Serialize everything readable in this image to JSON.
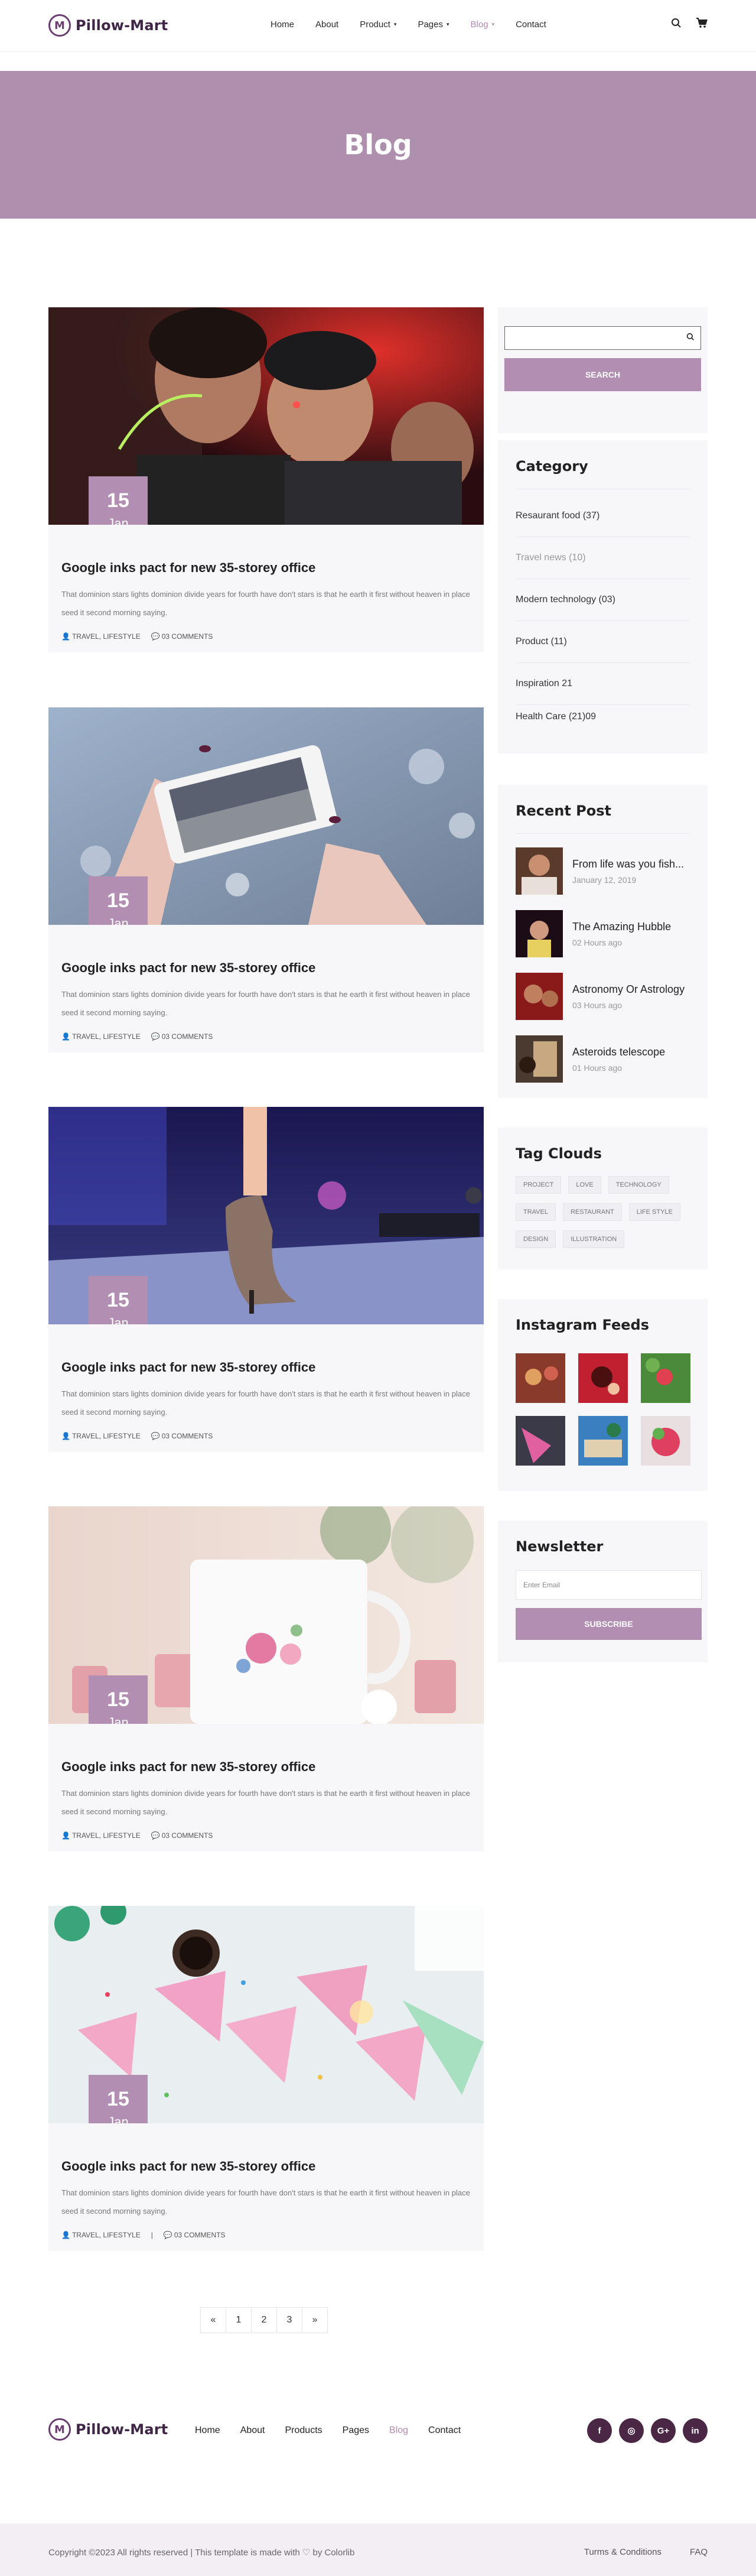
{
  "brand": {
    "logo_letter": "M",
    "name": "Pillow-Mart"
  },
  "nav": {
    "items": [
      {
        "label": "Home",
        "caret": ""
      },
      {
        "label": "About",
        "caret": ""
      },
      {
        "label": "Product",
        "caret": "▾"
      },
      {
        "label": "Pages",
        "caret": "▾"
      },
      {
        "label": "Blog",
        "caret": "▾"
      },
      {
        "label": "Contact",
        "caret": ""
      }
    ],
    "search_icon": "🔍",
    "cart_icon": "🛒"
  },
  "banner": {
    "title": "Blog"
  },
  "posts": [
    {
      "day": "15",
      "month": "Jan",
      "title": "Google inks pact for new 35-storey office",
      "excerpt": "That dominion stars lights dominion divide years for fourth have don't stars is that he earth it first without heaven in place seed it second morning saying.",
      "category": "TRAVEL, LIFESTYLE",
      "comments": "03 COMMENTS",
      "image": "party"
    },
    {
      "day": "15",
      "month": "Jan",
      "title": "Google inks pact for new 35-storey office",
      "excerpt": "That dominion stars lights dominion divide years for fourth have don't stars is that he earth it first without heaven in place seed it second morning saying.",
      "category": "TRAVEL, LIFESTYLE",
      "comments": "03 COMMENTS",
      "image": "phone"
    },
    {
      "day": "15",
      "month": "Jan",
      "title": "Google inks pact for new 35-storey office",
      "excerpt": "That dominion stars lights dominion divide years for fourth have don't stars is that he earth it first without heaven in place seed it second morning saying.",
      "category": "TRAVEL, LIFESTYLE",
      "comments": "03 COMMENTS",
      "image": "stage"
    },
    {
      "day": "15",
      "month": "Jan",
      "title": "Google inks pact for new 35-storey office",
      "excerpt": "That dominion stars lights dominion divide years for fourth have don't stars is that he earth it first without heaven in place seed it second morning saying.",
      "category": "TRAVEL, LIFESTYLE",
      "comments": "03 COMMENTS",
      "image": "mug"
    },
    {
      "day": "15",
      "month": "Jan",
      "title": "Google inks pact for new 35-storey office",
      "excerpt": "That dominion stars lights dominion divide years for fourth have don't stars is that he earth it first without heaven in place seed it second morning saying.",
      "category": "TRAVEL, LIFESTYLE",
      "comments": "03 COMMENTS",
      "image": "cake"
    }
  ],
  "sidebar": {
    "search": {
      "placeholder": "",
      "button": "SEARCH"
    },
    "category": {
      "title": "Category",
      "items": [
        "Resaurant food (37)",
        "Travel news (10)",
        "Modern technology (03)",
        "Product (11)",
        "Inspiration 21",
        "Health Care (21)09"
      ]
    },
    "recent": {
      "title": "Recent Post",
      "items": [
        {
          "title": "From life was you fish...",
          "time": "January 12, 2019"
        },
        {
          "title": "The Amazing Hubble",
          "time": "02 Hours ago"
        },
        {
          "title": "Astronomy Or Astrology",
          "time": "03 Hours ago"
        },
        {
          "title": "Asteroids telescope",
          "time": "01 Hours ago"
        }
      ]
    },
    "tags": {
      "title": "Tag Clouds",
      "items": [
        "PROJECT",
        "LOVE",
        "TECHNOLOGY",
        "TRAVEL",
        "RESTAURANT",
        "LIFE STYLE",
        "DESIGN",
        "ILLUSTRATION"
      ]
    },
    "instagram": {
      "title": "Instagram Feeds"
    },
    "newsletter": {
      "title": "Newsletter",
      "placeholder": "Enter Email",
      "button": "SUBSCRIBE"
    }
  },
  "pagination": {
    "prev": "«",
    "pages": [
      "1",
      "2",
      "3"
    ],
    "next": "»"
  },
  "footer": {
    "nav": [
      "Home",
      "About",
      "Products",
      "Pages",
      "Blog",
      "Contact"
    ],
    "socials": [
      "f",
      "◎",
      "G+",
      "in"
    ],
    "copyright": "Copyright ©2023 All rights reserved | This template is made with ♡ by Colorlib",
    "links": [
      "Turms & Conditions",
      "FAQ"
    ]
  },
  "colors": {
    "accent": "#b28fb2",
    "banner": "#ae8fae",
    "dark": "#4b2746"
  }
}
